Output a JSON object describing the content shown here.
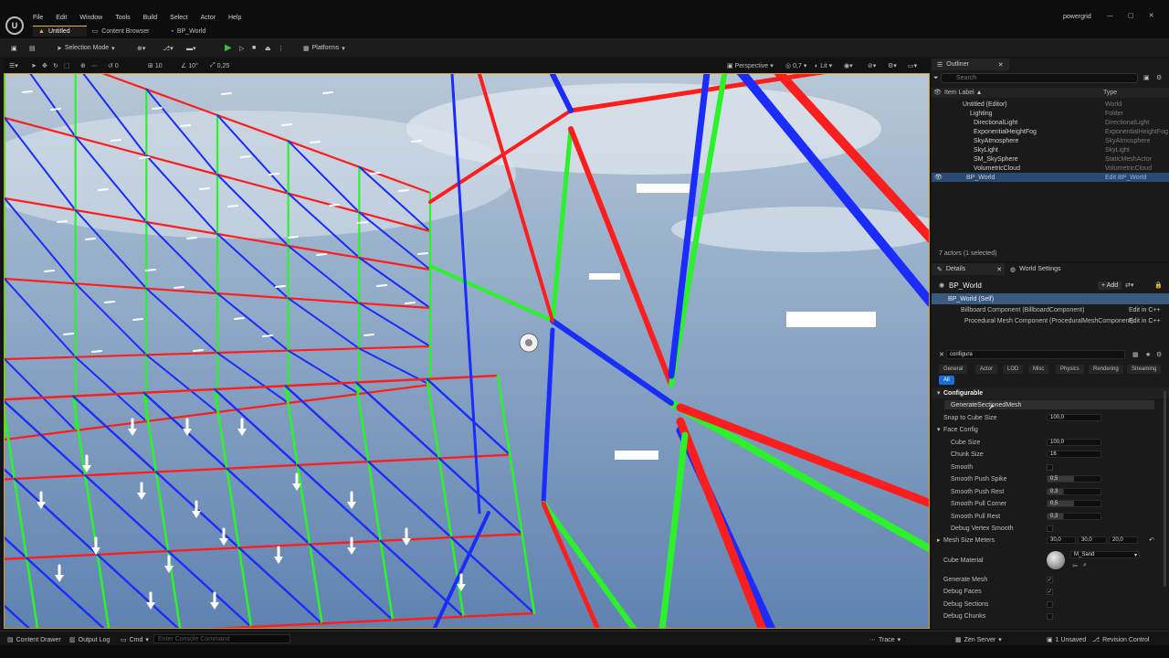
{
  "app": {
    "logo": "U",
    "menu": [
      "File",
      "Edit",
      "Window",
      "Tools",
      "Build",
      "Select",
      "Actor",
      "Help"
    ],
    "project_name": "powergrid",
    "tabs": [
      "Untitled",
      "Content Browser",
      "BP_World"
    ]
  },
  "toolbar": {
    "selection_mode": "Selection Mode",
    "platforms": "Platforms"
  },
  "viewport_toolbar": {
    "rotate_snap": "0",
    "grid_snap": "10",
    "angle_snap": "10°",
    "scale_snap": "0,25",
    "view_mode": "Perspective",
    "fov": "0,7",
    "lit": "Lit"
  },
  "outliner": {
    "tab": "Outliner",
    "search_placeholder": "Search",
    "col_label": "Item Label ▲",
    "col_type": "Type",
    "rows": [
      {
        "name": "Untitled (Editor)",
        "type": "World"
      },
      {
        "name": "Lighting",
        "type": "Folder"
      },
      {
        "name": "DirectionalLight",
        "type": "DirectionalLight"
      },
      {
        "name": "ExponentialHeightFog",
        "type": "ExponentialHeightFog"
      },
      {
        "name": "SkyAtmosphere",
        "type": "SkyAtmosphere"
      },
      {
        "name": "SkyLight",
        "type": "SkyLight"
      },
      {
        "name": "SM_SkySphere",
        "type": "StaticMeshActor"
      },
      {
        "name": "VolumetricCloud",
        "type": "VolumetricCloud"
      },
      {
        "name": "BP_World",
        "type": "Edit BP_World"
      }
    ],
    "count": "7 actors (1 selected)"
  },
  "details": {
    "tab": "Details",
    "tab2": "World Settings",
    "actor": "BP_World",
    "add": "+ Add",
    "self": "BP_World (Self)",
    "comp1": "Billboard Component (BillboardComponent)",
    "comp2": "Procedural Mesh Component (ProceduralMeshComponent)",
    "edit_cpp": "Edit in C++",
    "search": "configura",
    "categories": [
      "General",
      "Actor",
      "LOD",
      "Misc",
      "Physics",
      "Rendering",
      "Streaming",
      "All"
    ],
    "section": "Configurable",
    "gen_button": "GenerateSectionedMesh",
    "snap_label": "Snap to Cube Size",
    "snap_value": "100,0",
    "face_config": "Face Config",
    "cube_size_label": "Cube Size",
    "cube_size": "100,0",
    "chunk_size_label": "Chunk Size",
    "chunk_size": "16",
    "smooth_label": "Smooth",
    "spike_label": "Smooth Push Spike",
    "spike": "0,5",
    "push_rest_label": "Smooth Push Rest",
    "push_rest": "0,3",
    "pull_corner_label": "Smooth Pull Corner",
    "pull_corner": "0,5",
    "pull_rest_label": "Smooth Pull Rest",
    "pull_rest": "0,3",
    "debug_vertex_label": "Debug Vertex Smooth",
    "mesh_size_label": "Mesh Size Meters",
    "mesh_x": "30,0",
    "mesh_y": "30,0",
    "mesh_z": "20,0",
    "cube_material_label": "Cube Material",
    "cube_material": "M_Sand",
    "gen_mesh_label": "Generate Mesh",
    "debug_faces_label": "Debug Faces",
    "debug_sections_label": "Debug Sections",
    "debug_chunks_label": "Debug Chunks",
    "check_mark": "✓"
  },
  "status": {
    "content_drawer": "Content Drawer",
    "output_log": "Output Log",
    "cmd": "Cmd",
    "cmd_placeholder": "Enter Console Command",
    "trace": "Trace",
    "zen": "Zen Server",
    "unsaved": "1 Unsaved",
    "revision": "Revision Control"
  }
}
